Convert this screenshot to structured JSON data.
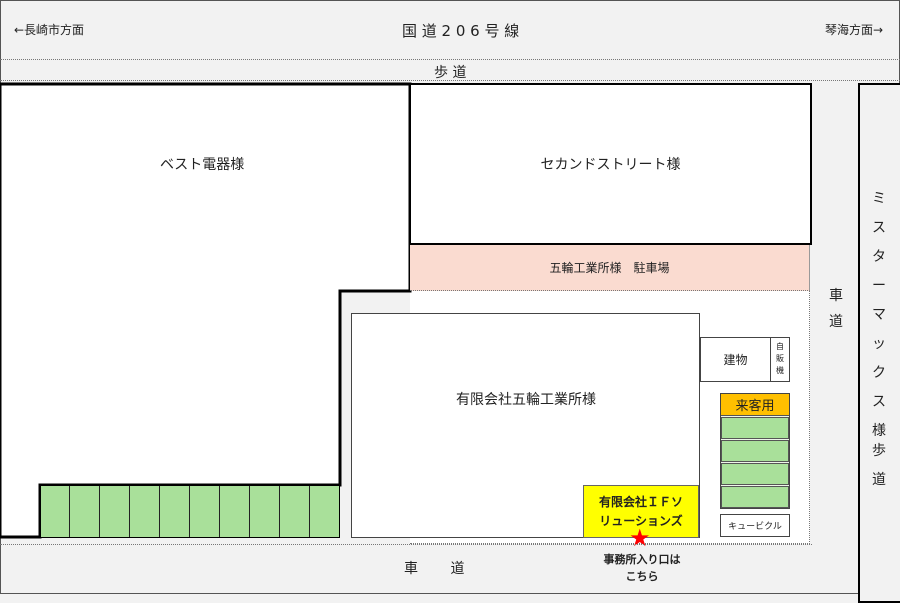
{
  "top": {
    "left_direction": "←長崎市方面",
    "road_name": "国 道 2 0 6 号 線",
    "right_direction": "琴海方面→"
  },
  "sidewalk_top": "歩 道",
  "buildings": {
    "best_denki": "ベスト電器様",
    "second_street": "セカンドストリート様",
    "gorin_parking": "五輪工業所様　駐車場",
    "gorin_main": "有限会社五輪工業所様",
    "building_small": "建物",
    "vending": "自販機",
    "cubicle": "キュービクル"
  },
  "visitor_parking": "来客用",
  "roads": {
    "right_road": "車道",
    "bottom_road": "車 道"
  },
  "mistermax": {
    "name": "ミスターマックス様",
    "sidewalk": "歩道"
  },
  "target": {
    "company_line1": "有限会社ＩＦソ",
    "company_line2": "リューションズ",
    "entrance_line1": "事務所入り口は",
    "entrance_line2": "こちら",
    "marker_color": "#ff0000",
    "highlight_color": "#ffff00"
  },
  "colors": {
    "parking_green": "#a9e09a",
    "parking_pink": "#fadbd0",
    "visitor_orange": "#ffc000"
  }
}
